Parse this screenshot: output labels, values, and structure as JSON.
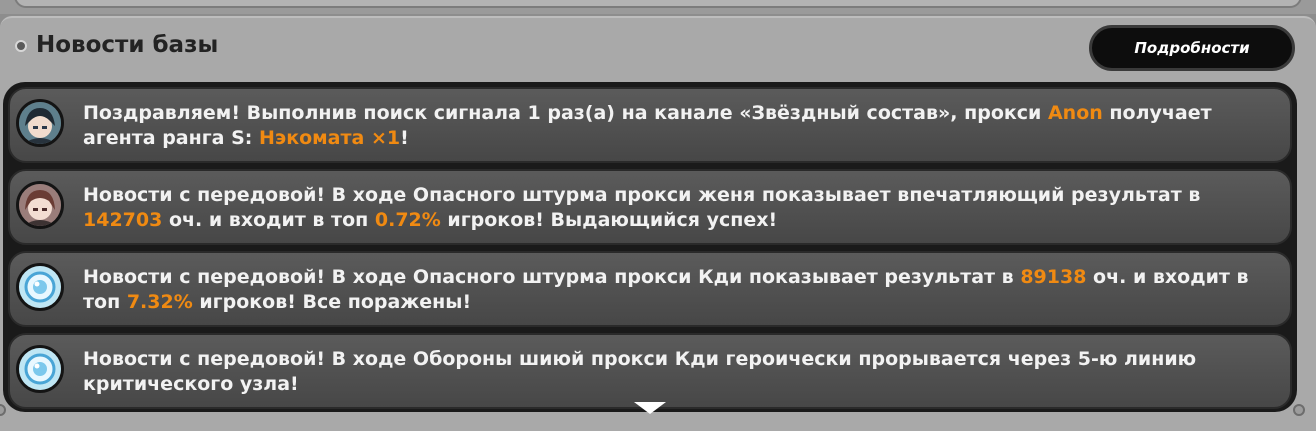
{
  "header": {
    "title": "Новости базы",
    "details_label": "Подробности"
  },
  "colors": {
    "highlight": "#f08a12",
    "text": "#f2f2f2",
    "item_bg": "#4f4f4f"
  },
  "news": [
    {
      "avatar": "dark-haired-girl-avatar",
      "parts": [
        "Поздравляем! Выполнив поиск сигнала 1 раз(а) на канале «Звёздный состав», прокси ",
        "Anon",
        " получает агента ранга S: ",
        "Нэкомата ×1",
        "!"
      ]
    },
    {
      "avatar": "brown-haired-girl-avatar",
      "parts": [
        "Новости с передовой! В ходе Опасного штурма прокси женя показывает впечатляющий результат в ",
        "142703",
        " оч. и входит в топ ",
        "0.72%",
        " игроков! Выдающийся успех!"
      ]
    },
    {
      "avatar": "default-blue-avatar",
      "parts": [
        "Новости с передовой! В ходе Опасного штурма прокси Кди показывает результат в ",
        "89138",
        " оч. и входит в топ ",
        "7.32%",
        " игроков! Все поражены!"
      ]
    },
    {
      "avatar": "default-blue-avatar",
      "parts": [
        "Новости с передовой! В ходе Обороны шиюй прокси Кди героически прорывается через 5-ю линию критического узла!"
      ]
    }
  ]
}
